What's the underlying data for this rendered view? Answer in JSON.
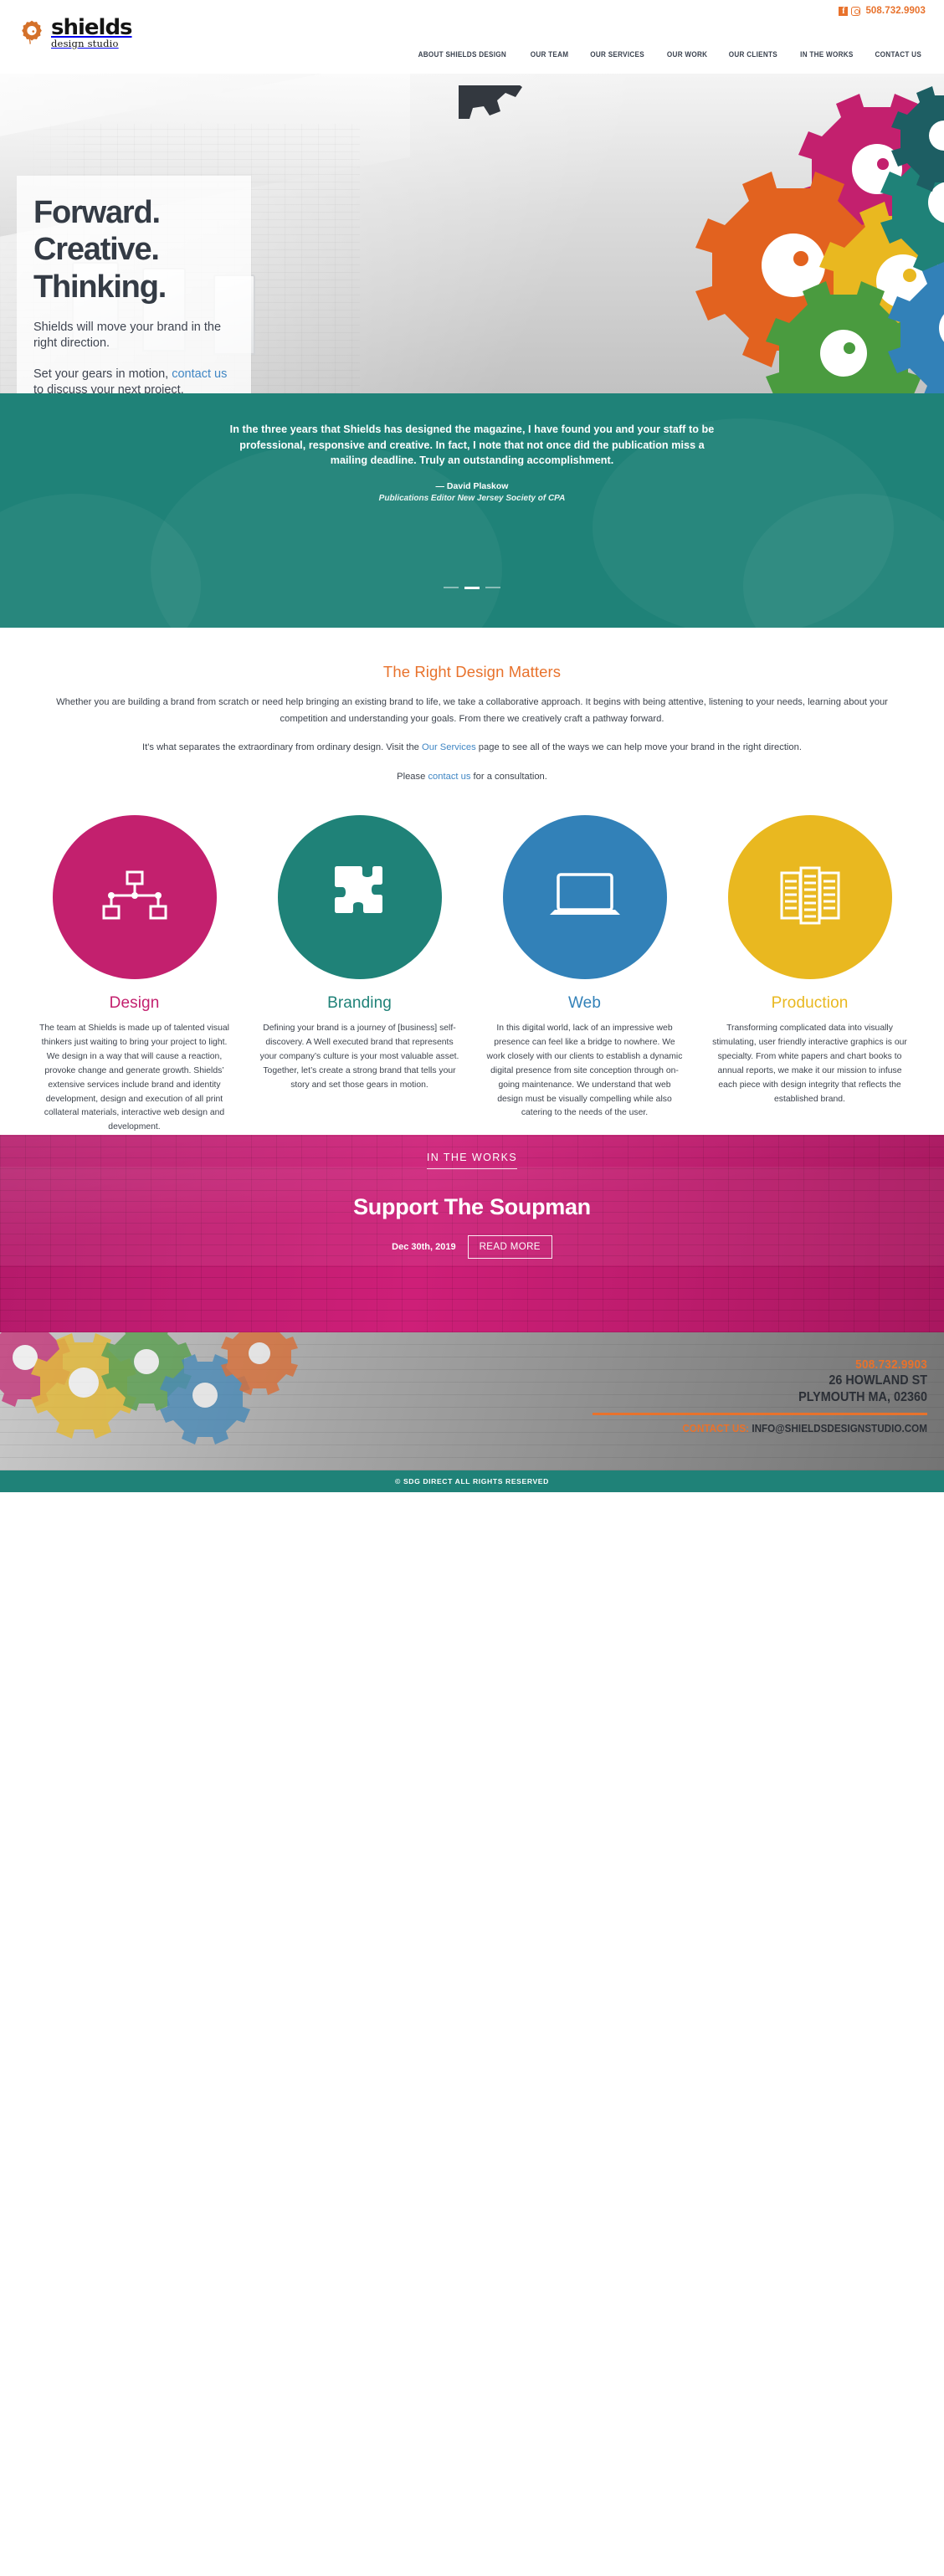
{
  "topbar": {
    "facebook_icon": "facebook-icon",
    "instagram_icon": "instagram-icon",
    "phone": "508.732.9903"
  },
  "logo": {
    "main": "shields",
    "sub": "design studio"
  },
  "nav": {
    "items": [
      {
        "label": "ABOUT SHIELDS DESIGN"
      },
      {
        "label": "OUR TEAM"
      },
      {
        "label": "OUR SERVICES"
      },
      {
        "label": "OUR WORK"
      },
      {
        "label": "OUR CLIENTS"
      },
      {
        "label": "IN THE WORKS"
      },
      {
        "label": "CONTACT US"
      }
    ]
  },
  "hero": {
    "line1": "Forward.",
    "line2": "Creative.",
    "line3": "Thinking.",
    "para1": "Shields will move your brand in the right direction.",
    "para2_pre": "Set your gears in motion, ",
    "para2_link": "contact us",
    "para2_post": " to discuss your next project."
  },
  "testimonial": {
    "quote": "In the three years that Shields has designed the magazine, I have found you and your staff to be professional, responsive and creative. In fact, I note that not once did the publication miss a mailing deadline. Truly an outstanding accomplishment.",
    "author": "— David Plaskow",
    "role": "Publications Editor New Jersey Society of CPA",
    "slides": 3,
    "active_slide": 2
  },
  "right_design": {
    "heading": "The Right Design Matters",
    "p1": "Whether you are building a brand from scratch or need help bringing an existing brand to life, we take a collaborative approach. It begins with being attentive, listening to your needs, learning about your competition and understanding your goals. From there we creatively craft a pathway forward.",
    "p2_pre": "It's what separates the extraordinary from ordinary design. Visit the ",
    "p2_link": "Our Services",
    "p2_post": " page to see all of the ways we can help move your brand in the right direction.",
    "p3_pre": "Please ",
    "p3_link": "contact us",
    "p3_post": " for a consultation."
  },
  "services": [
    {
      "title": "Design",
      "color": "#c3206e",
      "icon": "node-graph-icon",
      "body": "The team at Shields is made up of talented visual thinkers just waiting to bring your project to light. We design in a way that will cause a reaction, provoke change and generate growth. Shields’ extensive services include brand and identity development, design and execution of all print collateral materials, interactive web design and development."
    },
    {
      "title": "Branding",
      "color": "#1f8278",
      "icon": "puzzle-piece-icon",
      "body": "Defining your brand is a journey of [business] self-discovery. A Well executed brand that represents your company’s culture is your most valuable asset. Together, let’s create a strong brand that tells your story and set those gears in motion."
    },
    {
      "title": "Web",
      "color": "#3281b8",
      "icon": "laptop-icon",
      "body": "In this digital world, lack of an impressive web presence can feel like a bridge to nowhere. We work closely with our clients to establish a dynamic digital presence from site conception through on-going maintenance. We understand that web design must be visually compelling while also catering to the needs of the user."
    },
    {
      "title": "Production",
      "color": "#e9b820",
      "icon": "documents-icon",
      "body": "Transforming complicated data into visually stimulating, user friendly interactive graphics is our specialty. From white papers and chart books to annual reports, we make it our mission to infuse each piece with design integrity that reflects the established brand."
    }
  ],
  "works": {
    "label": "IN THE WORKS",
    "title": "Support The Soupman",
    "date": "Dec 30th, 2019",
    "button": "READ MORE"
  },
  "footer": {
    "phone": "508.732.9903",
    "address_line1": "26 HOWLAND ST",
    "address_line2": "PLYMOUTH MA, 02360",
    "contact_label": "CONTACT US:",
    "email": "INFO@SHIELDSDESIGNSTUDIO.COM"
  },
  "copyright": "© SDG DIRECT ALL RIGHTS RESERVED"
}
